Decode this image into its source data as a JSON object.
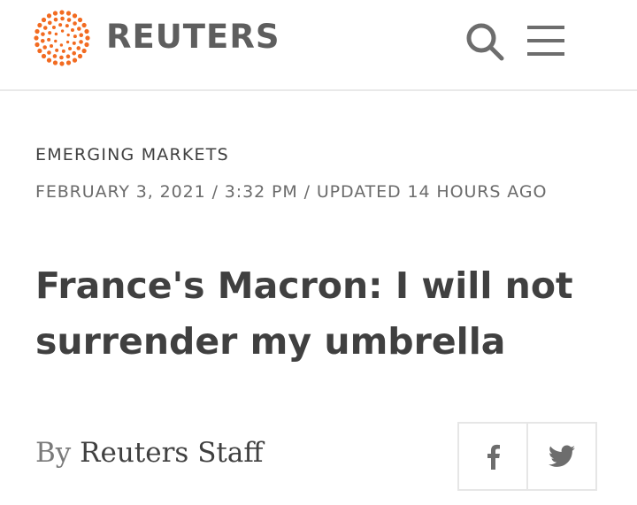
{
  "header": {
    "brand": "REUTERS",
    "logo_icon": "reuters-dot-logo-icon",
    "search_icon": "search-icon",
    "menu_icon": "menu-icon",
    "accent_color": "#f26b21"
  },
  "article": {
    "section": "EMERGING MARKETS",
    "dateline": "FEBRUARY 3, 2021 / 3:32 PM / UPDATED 14 HOURS AGO",
    "headline": "France's Macron: I will not surrender my umbrella",
    "byline_prefix": "By",
    "byline_author": "Reuters Staff"
  },
  "share": {
    "facebook_icon": "facebook-icon",
    "twitter_icon": "twitter-icon"
  }
}
